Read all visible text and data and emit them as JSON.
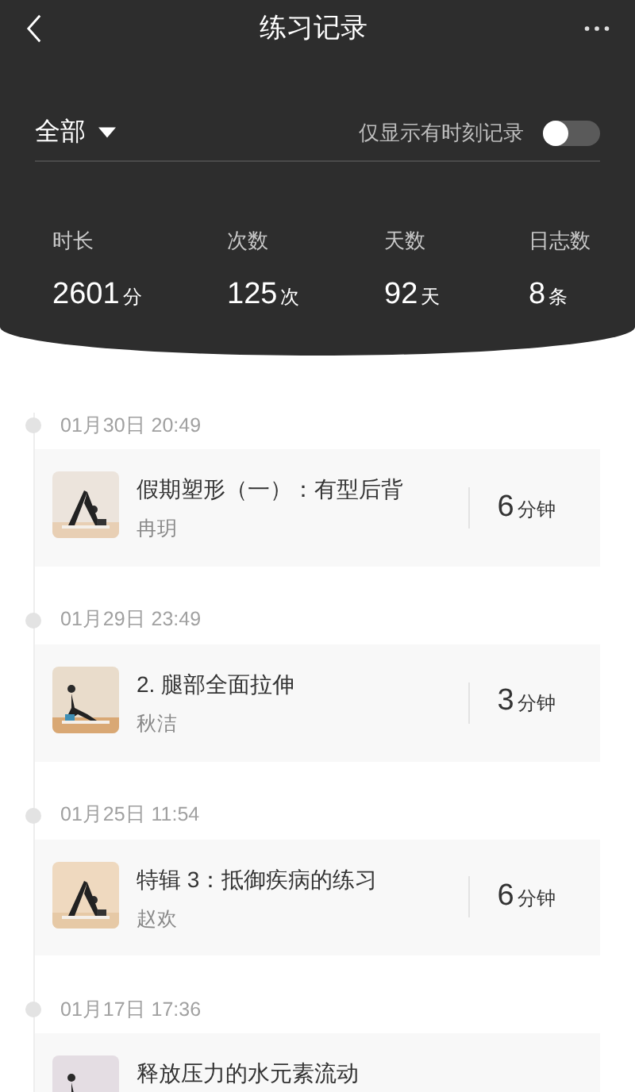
{
  "header": {
    "title": "练习记录"
  },
  "filter": {
    "label": "全部",
    "toggle": {
      "label": "仅显示有时刻记录",
      "on": false
    }
  },
  "stats": [
    {
      "label": "时长",
      "value": "2601",
      "unit": "分"
    },
    {
      "label": "次数",
      "value": "125",
      "unit": "次"
    },
    {
      "label": "天数",
      "value": "92",
      "unit": "天"
    },
    {
      "label": "日志数",
      "value": "8",
      "unit": "条"
    }
  ],
  "records": [
    {
      "time": "01月30日 20:49",
      "title": "假期塑形（一）：有型后背",
      "coach": "冉玥",
      "duration": "6",
      "unit": "分钟"
    },
    {
      "time": "01月29日 23:49",
      "title": "2. 腿部全面拉伸",
      "coach": "秋洁",
      "duration": "3",
      "unit": "分钟"
    },
    {
      "time": "01月25日 11:54",
      "title": "特辑 3：抵御疾病的练习",
      "coach": "赵欢",
      "duration": "6",
      "unit": "分钟"
    },
    {
      "time": "01月17日 17:36",
      "title": "释放压力的水元素流动"
    }
  ]
}
